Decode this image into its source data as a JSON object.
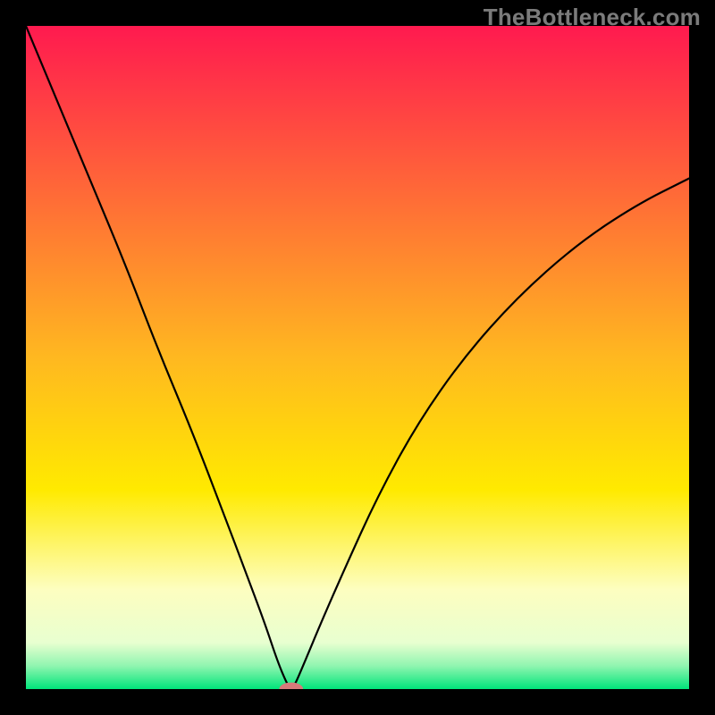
{
  "watermark": "TheBottleneck.com",
  "chart_data": {
    "type": "line",
    "title": "",
    "xlabel": "",
    "ylabel": "",
    "xlim": [
      0,
      1
    ],
    "ylim": [
      0,
      1
    ],
    "x_min_at": 0.4,
    "background_gradient": [
      {
        "offset": 0.0,
        "color": "#ff1a4f"
      },
      {
        "offset": 0.5,
        "color": "#ffb820"
      },
      {
        "offset": 0.7,
        "color": "#ffea00"
      },
      {
        "offset": 0.85,
        "color": "#fdfec0"
      },
      {
        "offset": 0.93,
        "color": "#e8ffd0"
      },
      {
        "offset": 0.965,
        "color": "#90f5b0"
      },
      {
        "offset": 1.0,
        "color": "#00e57a"
      }
    ],
    "series": [
      {
        "name": "bottleneck-curve",
        "x": [
          0.0,
          0.05,
          0.1,
          0.15,
          0.2,
          0.25,
          0.3,
          0.33,
          0.36,
          0.38,
          0.395,
          0.4,
          0.405,
          0.42,
          0.445,
          0.48,
          0.53,
          0.59,
          0.66,
          0.74,
          0.83,
          0.92,
          1.0
        ],
        "y": [
          1.0,
          0.88,
          0.76,
          0.64,
          0.51,
          0.39,
          0.26,
          0.18,
          0.1,
          0.04,
          0.005,
          0.0,
          0.005,
          0.04,
          0.1,
          0.18,
          0.29,
          0.4,
          0.5,
          0.59,
          0.67,
          0.73,
          0.77
        ]
      }
    ],
    "marker": {
      "x": 0.4,
      "y": 0.0,
      "rx": 0.018,
      "ry": 0.01,
      "color": "#d77a7a"
    }
  }
}
